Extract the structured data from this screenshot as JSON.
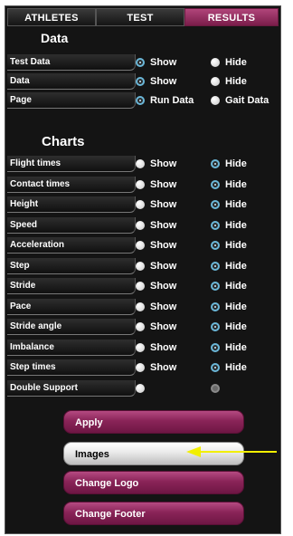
{
  "tabs": [
    {
      "label": "ATHLETES"
    },
    {
      "label": "TEST"
    },
    {
      "label": "RESULTS"
    }
  ],
  "data_section": {
    "title": "Data",
    "rows": [
      {
        "label": "Test Data",
        "option_a": "Show",
        "option_b": "Hide",
        "selected": "a"
      },
      {
        "label": "Data",
        "option_a": "Show",
        "option_b": "Hide",
        "selected": "a"
      },
      {
        "label": "Page",
        "option_a": "Run Data",
        "option_b": "Gait Data",
        "selected": "a"
      }
    ]
  },
  "charts_section": {
    "title": "Charts",
    "rows": [
      {
        "label": "Flight times",
        "option_a": "Show",
        "option_b": "Hide",
        "selected": "b"
      },
      {
        "label": "Contact times",
        "option_a": "Show",
        "option_b": "Hide",
        "selected": "b"
      },
      {
        "label": "Height",
        "option_a": "Show",
        "option_b": "Hide",
        "selected": "b"
      },
      {
        "label": "Speed",
        "option_a": "Show",
        "option_b": "Hide",
        "selected": "b"
      },
      {
        "label": "Acceleration",
        "option_a": "Show",
        "option_b": "Hide",
        "selected": "b"
      },
      {
        "label": "Step",
        "option_a": "Show",
        "option_b": "Hide",
        "selected": "b"
      },
      {
        "label": "Stride",
        "option_a": "Show",
        "option_b": "Hide",
        "selected": "b"
      },
      {
        "label": "Pace",
        "option_a": "Show",
        "option_b": "Hide",
        "selected": "b"
      },
      {
        "label": "Stride angle",
        "option_a": "Show",
        "option_b": "Hide",
        "selected": "b"
      },
      {
        "label": "Imbalance",
        "option_a": "Show",
        "option_b": "Hide",
        "selected": "b"
      },
      {
        "label": "Step times",
        "option_a": "Show",
        "option_b": "Hide",
        "selected": "b"
      },
      {
        "label": "Double Support",
        "option_a": "",
        "option_b": "",
        "selected": "none"
      }
    ]
  },
  "buttons": {
    "apply": "Apply",
    "images": "Images",
    "change_logo": "Change Logo",
    "change_footer": "Change Footer"
  },
  "colors": {
    "panel_bg": "#141414",
    "accent": "#8a2458",
    "radio_selected": "#6bb7d8",
    "annotation_arrow": "#f2ef00"
  },
  "annotation": {
    "icon": "arrow-left-icon",
    "color": "#f2ef00"
  }
}
